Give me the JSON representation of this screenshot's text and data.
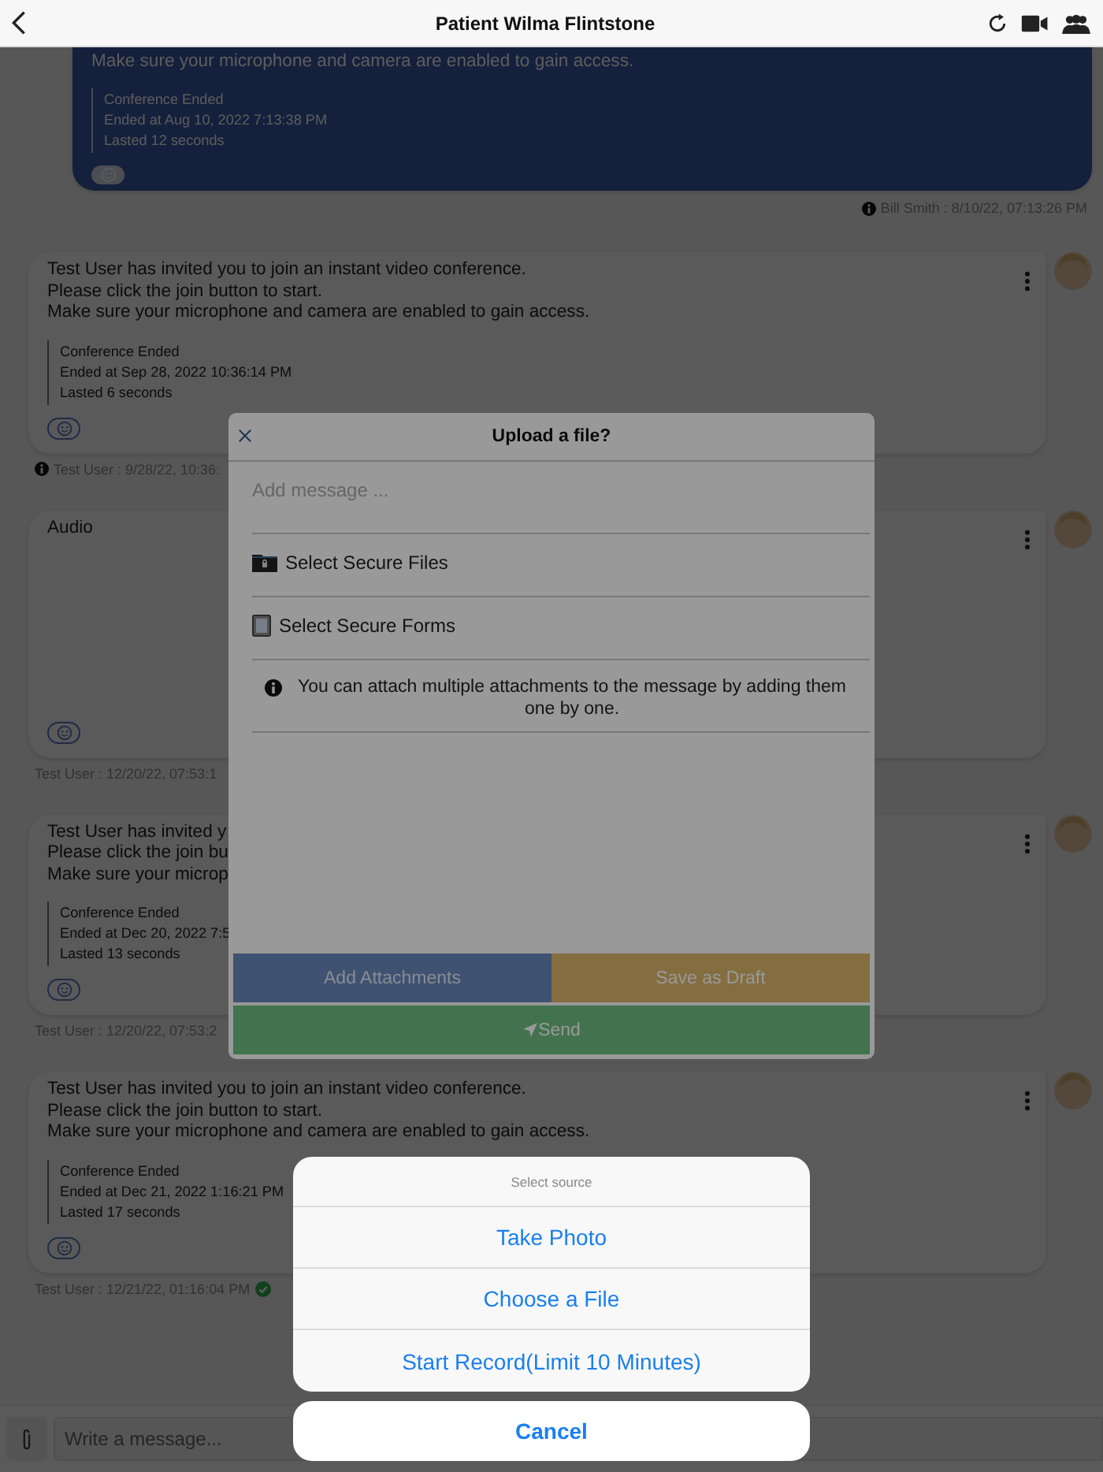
{
  "header": {
    "title": "Patient Wilma Flintstone"
  },
  "messages": [
    {
      "kind": "conference",
      "own": true,
      "lines": [
        "Make sure your microphone and camera are enabled to gain access."
      ],
      "details": [
        "Conference Ended",
        "Ended at Aug 10, 2022 7:13:38 PM",
        "Lasted 12 seconds"
      ],
      "footer": {
        "text": "Bill Smith : 8/10/22, 07:13:26 PM",
        "info": true,
        "delivered": false
      }
    },
    {
      "kind": "conference",
      "own": false,
      "lines": [
        "Test User has invited you to join an instant video conference.",
        "Please click the join button to start.",
        "Make sure your microphone and camera are enabled to gain access."
      ],
      "details": [
        "Conference Ended",
        "Ended at Sep 28, 2022 10:36:14 PM",
        "Lasted 6 seconds"
      ],
      "footer": {
        "text": "Test User : 9/28/22, 10:36:",
        "info": true,
        "delivered": false
      }
    },
    {
      "kind": "audio",
      "own": false,
      "lines": [
        "Audio"
      ],
      "footer": {
        "text": "Test User : 12/20/22, 07:53:1",
        "info": false,
        "delivered": false
      }
    },
    {
      "kind": "conference",
      "own": false,
      "lines": [
        "Test User has invited y",
        "Please click the join bu",
        "Make sure your microp"
      ],
      "details": [
        "Conference Ended",
        "Ended at Dec 20, 2022 7:5",
        "Lasted 13 seconds"
      ],
      "footer": {
        "text": "Test User : 12/20/22, 07:53:2",
        "info": false,
        "delivered": false
      }
    },
    {
      "kind": "conference",
      "own": false,
      "lines": [
        "Test User has invited you to join an instant video conference.",
        "Please click the join button to start.",
        "Make sure your microphone and camera are enabled to gain access."
      ],
      "details": [
        "Conference Ended",
        "Ended at Dec 21, 2022 1:16:21 PM",
        "Lasted 17 seconds"
      ],
      "footer": {
        "text": "Test User : 12/21/22, 01:16:04 PM",
        "info": false,
        "delivered": true
      }
    }
  ],
  "composer": {
    "placeholder": "Write a message..."
  },
  "dialog": {
    "title": "Upload a file?",
    "placeholder": "Add message ...",
    "options": [
      {
        "label": "Select Secure Files",
        "kind": "files"
      },
      {
        "label": "Select Secure Forms",
        "kind": "forms"
      }
    ],
    "note": "You can attach multiple attachments to the message by adding them one by one.",
    "buttons": [
      {
        "label": "Add Attachments",
        "kind": "attach"
      },
      {
        "label": "Save as Draft",
        "kind": "draft"
      },
      {
        "label": "Send",
        "kind": "send"
      }
    ]
  },
  "action_sheet": {
    "title": "Select source",
    "options": [
      "Take Photo",
      "Choose a File",
      "Start Record(Limit 10 Minutes)"
    ],
    "cancel": "Cancel"
  }
}
